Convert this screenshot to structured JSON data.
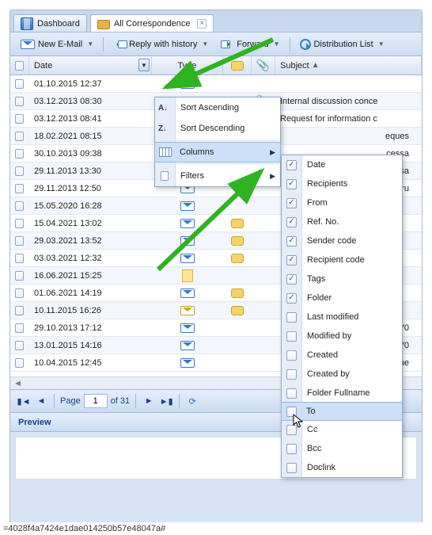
{
  "tabs": {
    "dashboard": "Dashboard",
    "active": "All Correspondence"
  },
  "toolbar": {
    "new_email": "New E-Mail",
    "reply_history": "Reply with history",
    "forward": "Forward",
    "distribution": "Distribution List"
  },
  "grid": {
    "headers": {
      "date": "Date",
      "type": "Type",
      "subject": "Subject"
    },
    "rows": [
      {
        "date": "01.10.2015 12:37",
        "type": "mail",
        "flag": false,
        "clip": false,
        "subject": ""
      },
      {
        "date": "03.12.2013 08:30",
        "type": "mail",
        "flag": false,
        "clip": true,
        "subject": "Internal discussion conce"
      },
      {
        "date": "03.12.2013 08:41",
        "type": "",
        "flag": false,
        "clip": false,
        "subject": "Request for information c"
      },
      {
        "date": "18.02.2021 08:15",
        "type": "mail",
        "flag": true,
        "clip": false,
        "subject": ""
      },
      {
        "date": "30.10.2013 09:38",
        "type": "mail",
        "flag": false,
        "clip": false,
        "subject": ""
      },
      {
        "date": "29.11.2013 13:30",
        "type": "mail",
        "flag": true,
        "clip": false,
        "subject": ""
      },
      {
        "date": "29.11.2013 12:50",
        "type": "mail",
        "flag": false,
        "clip": false,
        "subject": ""
      },
      {
        "date": "15.05.2020 16:28",
        "type": "mail",
        "flag": false,
        "clip": false,
        "subject": ""
      },
      {
        "date": "15.04.2021 13:02",
        "type": "mail",
        "flag": true,
        "clip": false,
        "subject": ""
      },
      {
        "date": "29.03.2021 13:52",
        "type": "mail",
        "flag": true,
        "clip": false,
        "subject": ""
      },
      {
        "date": "03.03.2021 12:32",
        "type": "mail",
        "flag": true,
        "clip": false,
        "subject": ""
      },
      {
        "date": "16.06.2021 15:25",
        "type": "note",
        "flag": false,
        "clip": false,
        "subject": ""
      },
      {
        "date": "01.06.2021 14:19",
        "type": "mail",
        "flag": true,
        "clip": false,
        "subject": ""
      },
      {
        "date": "10.11.2015 16:26",
        "type": "mail-y",
        "flag": true,
        "clip": false,
        "subject": ""
      },
      {
        "date": "29.10.2013 17:12",
        "type": "mail",
        "flag": false,
        "clip": false,
        "subject": ""
      },
      {
        "date": "13.01.2015 14:16",
        "type": "mail",
        "flag": false,
        "clip": false,
        "subject": ""
      },
      {
        "date": "10.04.2015 12:45",
        "type": "mail",
        "flag": false,
        "clip": false,
        "subject": ""
      }
    ],
    "subject_suffixes": {
      "3": "eques",
      "4": "cessa",
      "5": "cessa",
      "6": "constru",
      "14": "or IV0",
      "15": "or IV0",
      "16": "okume"
    }
  },
  "ctx1": {
    "sort_asc": "Sort Ascending",
    "sort_desc": "Sort Descending",
    "columns": "Columns",
    "filters": "Filters"
  },
  "ctx2_items": [
    {
      "label": "Date",
      "checked": true
    },
    {
      "label": "Recipients",
      "checked": true
    },
    {
      "label": "From",
      "checked": true
    },
    {
      "label": "Ref. No.",
      "checked": true
    },
    {
      "label": "Sender code",
      "checked": true
    },
    {
      "label": "Recipient code",
      "checked": true
    },
    {
      "label": "Tags",
      "checked": true
    },
    {
      "label": "Folder",
      "checked": true
    },
    {
      "label": "Last modified",
      "checked": false
    },
    {
      "label": "Modified by",
      "checked": false
    },
    {
      "label": "Created",
      "checked": false
    },
    {
      "label": "Created by",
      "checked": false
    },
    {
      "label": "Folder Fullname",
      "checked": false
    },
    {
      "label": "To",
      "checked": false,
      "hover": true
    },
    {
      "label": "Cc",
      "checked": false
    },
    {
      "label": "Bcc",
      "checked": false
    },
    {
      "label": "Doclink",
      "checked": false
    }
  ],
  "paging": {
    "page_label": "Page",
    "page_value": "1",
    "of_label": "of 31"
  },
  "preview": {
    "title": "Preview"
  },
  "status": "=4028f4a7424e1dae014250b57e48047a#"
}
